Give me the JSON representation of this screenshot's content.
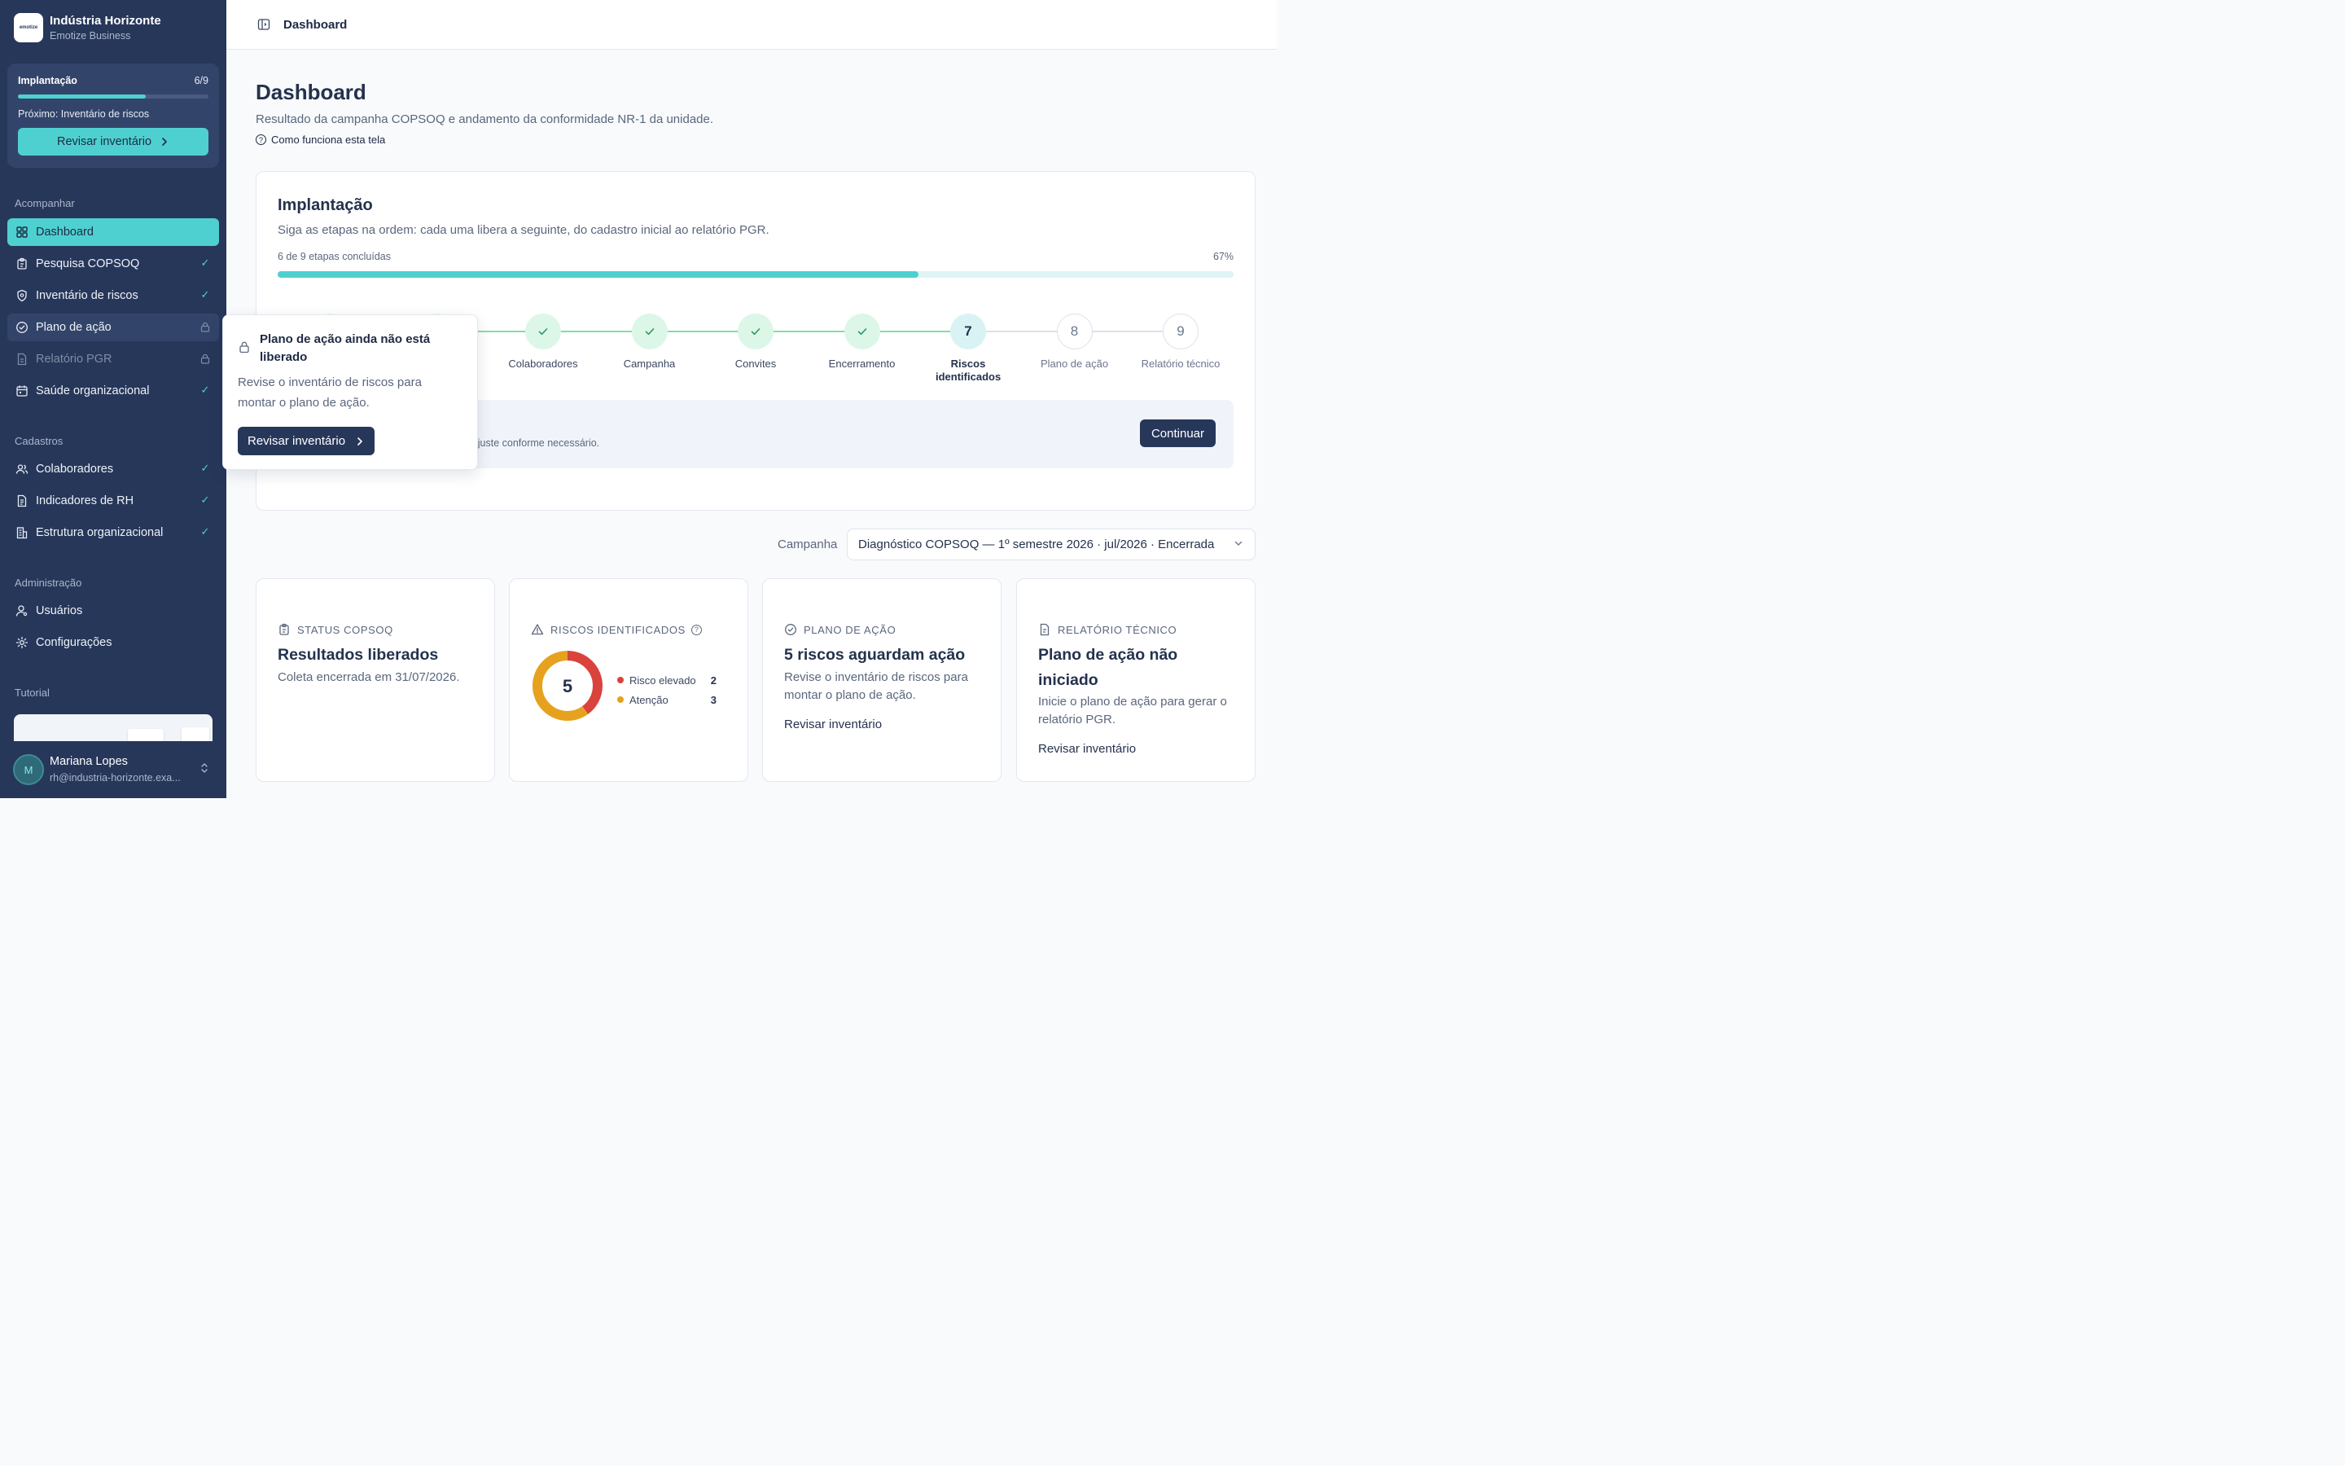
{
  "brand": {
    "name": "Indústria Horizonte",
    "subtitle": "Emotize Business",
    "logo_text": "emotize"
  },
  "implementation_card": {
    "title": "Implantação",
    "count": "6/9",
    "progress": 0.67,
    "next": "Próximo: Inventário de riscos",
    "button": "Revisar inventário"
  },
  "sidebar": {
    "sections": {
      "follow": "Acompanhar",
      "registers": "Cadastros",
      "admin": "Administração",
      "tutorial": "Tutorial"
    },
    "items": [
      {
        "label": "Dashboard",
        "icon": "grid-icon",
        "state": "active"
      },
      {
        "label": "Pesquisa COPSOQ",
        "icon": "clipboard-icon",
        "state": "done"
      },
      {
        "label": "Inventário de riscos",
        "icon": "shield-icon",
        "state": "done"
      },
      {
        "label": "Plano de ação",
        "icon": "check-circle-icon",
        "state": "locked"
      },
      {
        "label": "Relatório PGR",
        "icon": "document-icon",
        "state": "locked-disabled"
      },
      {
        "label": "Saúde organizacional",
        "icon": "calendar-icon",
        "state": "done"
      },
      {
        "label": "Colaboradores",
        "icon": "users-icon",
        "state": "done"
      },
      {
        "label": "Indicadores de RH",
        "icon": "report-icon",
        "state": "done"
      },
      {
        "label": "Estrutura organizacional",
        "icon": "building-icon",
        "state": "done"
      },
      {
        "label": "Usuários",
        "icon": "user-icon",
        "state": "none"
      },
      {
        "label": "Configurações",
        "icon": "gear-icon",
        "state": "none"
      }
    ]
  },
  "user": {
    "initial": "M",
    "name": "Mariana Lopes",
    "email": "rh@industria-horizonte.exa..."
  },
  "topbar": {
    "breadcrumb": "Dashboard"
  },
  "page": {
    "title": "Dashboard",
    "subtitle": "Resultado da campanha COPSOQ e andamento da conformidade NR-1 da unidade.",
    "help": "Como funciona esta tela"
  },
  "implementation": {
    "title": "Implantação",
    "description": "Siga as etapas na ordem: cada uma libera a seguinte, do cadastro inicial ao relatório PGR.",
    "count_text": "6 de 9 etapas concluídas",
    "percent": "67%",
    "progress": 0.67,
    "steps": [
      {
        "number": "1",
        "label": "",
        "state": "done"
      },
      {
        "number": "2",
        "label": "",
        "state": "done"
      },
      {
        "number": "3",
        "label": "Colaboradores",
        "state": "done"
      },
      {
        "number": "4",
        "label": "Campanha",
        "state": "done"
      },
      {
        "number": "5",
        "label": "Convites",
        "state": "done"
      },
      {
        "number": "6",
        "label": "Encerramento",
        "state": "done"
      },
      {
        "number": "7",
        "label": "Riscos identificados",
        "state": "current"
      },
      {
        "number": "8",
        "label": "Plano de ação",
        "state": "todo"
      },
      {
        "number": "9",
        "label": "Relatório técnico",
        "state": "todo"
      }
    ],
    "next_text": "nventário de riscos e ajuste conforme necessário.",
    "continue": "Continuar"
  },
  "campaign": {
    "label": "Campanha",
    "selected": "Diagnóstico COPSOQ — 1º semestre 2026 · jul/2026 · Encerrada"
  },
  "cards": {
    "status": {
      "head": "STATUS COPSOQ",
      "title": "Resultados liberados",
      "body": "Coleta encerrada em 31/07/2026."
    },
    "risks": {
      "head": "RISCOS IDENTIFICADOS",
      "total": "5",
      "legend": [
        {
          "label": "Risco elevado",
          "value": 2,
          "color": "#d9433b"
        },
        {
          "label": "Atenção",
          "value": 3,
          "color": "#e6a21e"
        }
      ]
    },
    "plan": {
      "head": "PLANO DE AÇÃO",
      "title": "5 riscos aguardam ação",
      "body": "Revise o inventário de riscos para montar o plano de ação.",
      "link": "Revisar inventário"
    },
    "report": {
      "head": "RELATÓRIO TÉCNICO",
      "title": "Plano de ação não iniciado",
      "body": "Inicie o plano de ação para gerar o relatório PGR.",
      "link": "Revisar inventário"
    }
  },
  "popover": {
    "title": "Plano de ação ainda não está liberado",
    "body": "Revise o inventário de riscos para montar o plano de ação.",
    "button": "Revisar inventário"
  },
  "colors": {
    "sidebar": "#27375a",
    "accent": "#4fd0d0",
    "done": "#2b9a5c",
    "danger": "#d9433b",
    "warning": "#e6a21e"
  }
}
